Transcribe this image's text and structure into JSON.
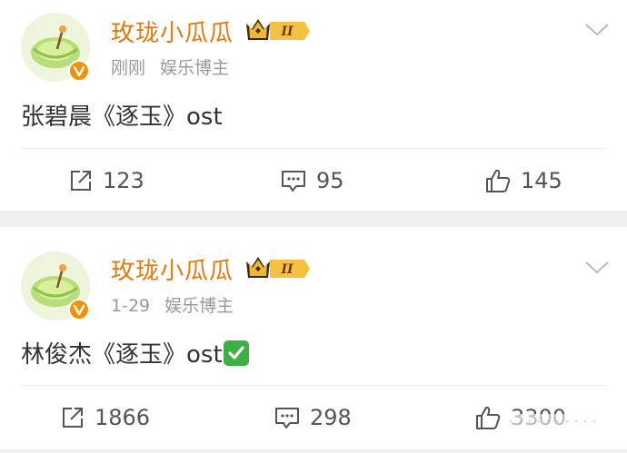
{
  "posts": [
    {
      "username": "玫珑小瓜瓜",
      "vip_level": "II",
      "time": "刚刚",
      "tag": "娱乐博主",
      "text": "张碧晨《逐玉》ost",
      "reposts": "123",
      "comments": "95",
      "likes": "145"
    },
    {
      "username": "玫珑小瓜瓜",
      "vip_level": "II",
      "time": "1-29",
      "tag": "娱乐博主",
      "text": "林俊杰《逐玉》ost",
      "emoji": "check-mark-button",
      "reposts": "1866",
      "comments": "298",
      "likes": "3300"
    }
  ],
  "colors": {
    "username": "#e8770e",
    "meta": "#999999",
    "text": "#333333",
    "action": "#555555",
    "verified": "#f29200",
    "separator": "#efefef"
  },
  "watermark": "· · · · · · · · · ·"
}
